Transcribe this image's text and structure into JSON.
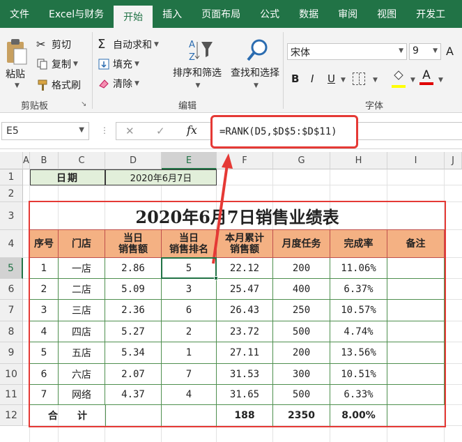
{
  "tabs": [
    "文件",
    "Excel与财务",
    "开始",
    "插入",
    "页面布局",
    "公式",
    "数据",
    "审阅",
    "视图",
    "开发工"
  ],
  "active_tab": "开始",
  "ribbon": {
    "clipboard": {
      "paste": "粘贴",
      "cut": "剪切",
      "copy": "复制",
      "format_painter": "格式刷",
      "label": "剪贴板"
    },
    "editing": {
      "autosum": "自动求和",
      "fill": "填充",
      "clear": "清除",
      "sort_filter": "排序和筛选",
      "find_select": "查找和选择",
      "label": "编辑"
    },
    "font": {
      "name": "宋体",
      "size": "9",
      "bold": "B",
      "italic": "I",
      "underline": "U",
      "font_color": "A",
      "label": "字体"
    }
  },
  "formula_bar": {
    "name_box": "E5",
    "cancel": "✕",
    "enter": "✓",
    "fx": "fx",
    "formula": "=RANK(D5,$D$5:$D$11)"
  },
  "columns": [
    "A",
    "B",
    "C",
    "D",
    "E",
    "F",
    "G",
    "H",
    "I",
    "J"
  ],
  "rows": [
    "1",
    "2",
    "3",
    "4",
    "5",
    "6",
    "7",
    "8",
    "9",
    "10",
    "11",
    "12"
  ],
  "sheet": {
    "date_label": "日期",
    "date_value": "2020年6月7日",
    "title": "2020年6月7日销售业绩表",
    "headers": [
      "序号",
      "门店",
      "当日\n销售额",
      "当日\n销售排名",
      "本月累计\n销售额",
      "月度任务",
      "完成率",
      "备注"
    ],
    "data": [
      [
        "1",
        "一店",
        "2.86",
        "5",
        "22.12",
        "200",
        "11.06%",
        ""
      ],
      [
        "2",
        "二店",
        "5.09",
        "3",
        "25.47",
        "400",
        "6.37%",
        ""
      ],
      [
        "3",
        "三店",
        "2.36",
        "6",
        "26.43",
        "250",
        "10.57%",
        ""
      ],
      [
        "4",
        "四店",
        "5.27",
        "2",
        "23.72",
        "500",
        "4.74%",
        ""
      ],
      [
        "5",
        "五店",
        "5.34",
        "1",
        "27.11",
        "200",
        "13.56%",
        ""
      ],
      [
        "6",
        "六店",
        "2.07",
        "7",
        "31.53",
        "300",
        "10.51%",
        ""
      ],
      [
        "7",
        "网络",
        "4.37",
        "4",
        "31.65",
        "500",
        "6.33%",
        ""
      ]
    ],
    "total_label": "合　　计",
    "totals": [
      "188",
      "2350",
      "8.00%"
    ]
  },
  "colors": {
    "accent": "#217346",
    "header_fill": "#f4b183",
    "date_fill": "#e2efda",
    "highlight": "#e53935"
  }
}
